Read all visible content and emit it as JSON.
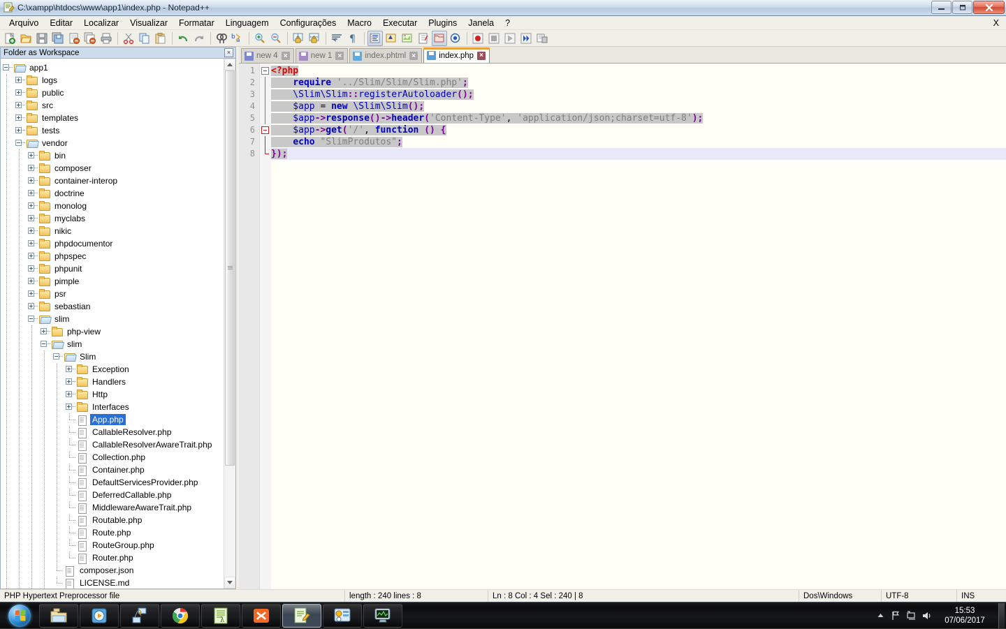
{
  "window": {
    "title": "C:\\xampp\\htdocs\\www\\app1\\index.php - Notepad++",
    "minimize_label": "—",
    "maximize_label": "❐",
    "close_label": "✕"
  },
  "menu": {
    "items": [
      {
        "label": "Arquivo"
      },
      {
        "label": "Editar"
      },
      {
        "label": "Localizar"
      },
      {
        "label": "Visualizar"
      },
      {
        "label": "Formatar"
      },
      {
        "label": "Linguagem"
      },
      {
        "label": "Configurações"
      },
      {
        "label": "Macro"
      },
      {
        "label": "Executar"
      },
      {
        "label": "Plugins"
      },
      {
        "label": "Janela"
      },
      {
        "label": "?"
      }
    ],
    "right_label": "X"
  },
  "toolbar": {
    "icons": [
      "new-file-icon",
      "open-file-icon",
      "save-icon",
      "save-all-icon",
      "close-file-icon",
      "close-all-icon",
      "print-icon",
      "cut-icon",
      "copy-icon",
      "paste-icon",
      "undo-icon",
      "redo-icon",
      "find-icon",
      "replace-icon",
      "zoom-in-icon",
      "zoom-out-icon",
      "sync-vertical-icon",
      "sync-horizontal-icon",
      "word-wrap-icon",
      "show-all-chars-icon",
      "indent-guide-icon",
      "user-language-icon",
      "document-map-icon",
      "function-list-icon",
      "folder-as-workspace-icon",
      "monitoring-icon",
      "record-macro-icon",
      "stop-record-icon",
      "play-macro-icon",
      "run-macro-multiple-icon",
      "save-macro-icon"
    ]
  },
  "panel": {
    "caption": "Folder as Workspace",
    "close_label": "×",
    "tree": [
      {
        "label": "app1",
        "depth": 0,
        "type": "project",
        "state": "expanded"
      },
      {
        "label": "logs",
        "depth": 1,
        "type": "folder",
        "state": "collapsed"
      },
      {
        "label": "public",
        "depth": 1,
        "type": "folder",
        "state": "collapsed"
      },
      {
        "label": "src",
        "depth": 1,
        "type": "folder",
        "state": "collapsed"
      },
      {
        "label": "templates",
        "depth": 1,
        "type": "folder",
        "state": "collapsed"
      },
      {
        "label": "tests",
        "depth": 1,
        "type": "folder",
        "state": "collapsed"
      },
      {
        "label": "vendor",
        "depth": 1,
        "type": "project",
        "state": "expanded"
      },
      {
        "label": "bin",
        "depth": 2,
        "type": "folder",
        "state": "collapsed"
      },
      {
        "label": "composer",
        "depth": 2,
        "type": "folder",
        "state": "collapsed"
      },
      {
        "label": "container-interop",
        "depth": 2,
        "type": "folder",
        "state": "collapsed"
      },
      {
        "label": "doctrine",
        "depth": 2,
        "type": "folder",
        "state": "collapsed"
      },
      {
        "label": "monolog",
        "depth": 2,
        "type": "folder",
        "state": "collapsed"
      },
      {
        "label": "myclabs",
        "depth": 2,
        "type": "folder",
        "state": "collapsed"
      },
      {
        "label": "nikic",
        "depth": 2,
        "type": "folder",
        "state": "collapsed"
      },
      {
        "label": "phpdocumentor",
        "depth": 2,
        "type": "folder",
        "state": "collapsed"
      },
      {
        "label": "phpspec",
        "depth": 2,
        "type": "folder",
        "state": "collapsed"
      },
      {
        "label": "phpunit",
        "depth": 2,
        "type": "folder",
        "state": "collapsed"
      },
      {
        "label": "pimple",
        "depth": 2,
        "type": "folder",
        "state": "collapsed"
      },
      {
        "label": "psr",
        "depth": 2,
        "type": "folder",
        "state": "collapsed"
      },
      {
        "label": "sebastian",
        "depth": 2,
        "type": "folder",
        "state": "collapsed"
      },
      {
        "label": "slim",
        "depth": 2,
        "type": "project",
        "state": "expanded"
      },
      {
        "label": "php-view",
        "depth": 3,
        "type": "folder",
        "state": "collapsed"
      },
      {
        "label": "slim",
        "depth": 3,
        "type": "project",
        "state": "expanded"
      },
      {
        "label": "Slim",
        "depth": 4,
        "type": "project",
        "state": "expanded"
      },
      {
        "label": "Exception",
        "depth": 5,
        "type": "folder",
        "state": "collapsed"
      },
      {
        "label": "Handlers",
        "depth": 5,
        "type": "folder",
        "state": "collapsed"
      },
      {
        "label": "Http",
        "depth": 5,
        "type": "folder",
        "state": "collapsed"
      },
      {
        "label": "Interfaces",
        "depth": 5,
        "type": "folder",
        "state": "collapsed"
      },
      {
        "label": "App.php",
        "depth": 5,
        "type": "file",
        "state": "selected"
      },
      {
        "label": "CallableResolver.php",
        "depth": 5,
        "type": "file",
        "state": "none"
      },
      {
        "label": "CallableResolverAwareTrait.php",
        "depth": 5,
        "type": "file",
        "state": "none"
      },
      {
        "label": "Collection.php",
        "depth": 5,
        "type": "file",
        "state": "none"
      },
      {
        "label": "Container.php",
        "depth": 5,
        "type": "file",
        "state": "none"
      },
      {
        "label": "DefaultServicesProvider.php",
        "depth": 5,
        "type": "file",
        "state": "none"
      },
      {
        "label": "DeferredCallable.php",
        "depth": 5,
        "type": "file",
        "state": "none"
      },
      {
        "label": "MiddlewareAwareTrait.php",
        "depth": 5,
        "type": "file",
        "state": "none"
      },
      {
        "label": "Routable.php",
        "depth": 5,
        "type": "file",
        "state": "none"
      },
      {
        "label": "Route.php",
        "depth": 5,
        "type": "file",
        "state": "none"
      },
      {
        "label": "RouteGroup.php",
        "depth": 5,
        "type": "file",
        "state": "none"
      },
      {
        "label": "Router.php",
        "depth": 5,
        "type": "file",
        "state": "none"
      },
      {
        "label": "composer.json",
        "depth": 4,
        "type": "file",
        "state": "none"
      },
      {
        "label": "LICENSE.md",
        "depth": 4,
        "type": "file",
        "state": "none"
      }
    ]
  },
  "tabs": [
    {
      "label": "new 4",
      "active": false,
      "close_label": "×",
      "icon_color": "#6f77c8"
    },
    {
      "label": "new 1",
      "active": false,
      "close_label": "×",
      "icon_color": "#9b7fc0"
    },
    {
      "label": "index.phtml",
      "active": false,
      "close_label": "×",
      "icon_color": "#4aa3e0"
    },
    {
      "label": "index.php",
      "active": true,
      "close_label": "×",
      "icon_color": "#3b8fd4"
    }
  ],
  "editor": {
    "line_numbers": [
      "1",
      "2",
      "3",
      "4",
      "5",
      "6",
      "7",
      "8"
    ],
    "lines": [
      {
        "n": 1,
        "tokens": [
          {
            "t": "<?php",
            "c": "k-tag",
            "sel": true
          }
        ]
      },
      {
        "n": 2,
        "tokens": [
          {
            "t": "    ",
            "c": "k-plain",
            "sel": true
          },
          {
            "t": "require",
            "c": "k-kw",
            "sel": true
          },
          {
            "t": " ",
            "c": "k-plain",
            "sel": true
          },
          {
            "t": "'../Slim/Slim/Slim.php'",
            "c": "k-str",
            "sel": true
          },
          {
            "t": ";",
            "c": "k-op",
            "sel": true
          }
        ]
      },
      {
        "n": 3,
        "tokens": [
          {
            "t": "    \\Slim\\Slim",
            "c": "k-var",
            "sel": true
          },
          {
            "t": "::",
            "c": "k-op",
            "sel": true
          },
          {
            "t": "registerAutoloader",
            "c": "k-var",
            "sel": true
          },
          {
            "t": "()",
            "c": "k-op",
            "sel": true
          },
          {
            "t": ";",
            "c": "k-op",
            "sel": true
          }
        ]
      },
      {
        "n": 4,
        "tokens": [
          {
            "t": "    $app",
            "c": "k-var",
            "sel": true
          },
          {
            "t": " = ",
            "c": "k-plain",
            "sel": true
          },
          {
            "t": "new",
            "c": "k-kw",
            "sel": true
          },
          {
            "t": " \\Slim\\Slim",
            "c": "k-var",
            "sel": true
          },
          {
            "t": "()",
            "c": "k-op",
            "sel": true
          },
          {
            "t": ";",
            "c": "k-op",
            "sel": true
          }
        ]
      },
      {
        "n": 5,
        "tokens": [
          {
            "t": "    $app",
            "c": "k-var",
            "sel": true
          },
          {
            "t": "->",
            "c": "k-op",
            "sel": true
          },
          {
            "t": "response",
            "c": "k-fn",
            "sel": true
          },
          {
            "t": "()",
            "c": "k-op",
            "sel": true
          },
          {
            "t": "->",
            "c": "k-op",
            "sel": true
          },
          {
            "t": "header",
            "c": "k-fn",
            "sel": true
          },
          {
            "t": "(",
            "c": "k-op",
            "sel": true
          },
          {
            "t": "'Content-Type'",
            "c": "k-str",
            "sel": true
          },
          {
            "t": ", ",
            "c": "k-plain",
            "sel": true
          },
          {
            "t": "'application/json;charset=utf-8'",
            "c": "k-str",
            "sel": true
          },
          {
            "t": ")",
            "c": "k-op",
            "sel": true
          },
          {
            "t": ";",
            "c": "k-op",
            "sel": true
          }
        ]
      },
      {
        "n": 6,
        "tokens": [
          {
            "t": "    $app",
            "c": "k-var",
            "sel": true
          },
          {
            "t": "->",
            "c": "k-op",
            "sel": true
          },
          {
            "t": "get",
            "c": "k-fn",
            "sel": true
          },
          {
            "t": "(",
            "c": "k-op",
            "sel": true
          },
          {
            "t": "'/'",
            "c": "k-str",
            "sel": true
          },
          {
            "t": ", ",
            "c": "k-plain",
            "sel": true
          },
          {
            "t": "function",
            "c": "k-kw",
            "sel": true
          },
          {
            "t": " ",
            "c": "k-plain",
            "sel": true
          },
          {
            "t": "()",
            "c": "k-op",
            "sel": true
          },
          {
            "t": " ",
            "c": "k-plain",
            "sel": true
          },
          {
            "t": "{",
            "c": "k-op",
            "sel": true
          }
        ]
      },
      {
        "n": 7,
        "tokens": [
          {
            "t": "    ",
            "c": "k-plain",
            "sel": true
          },
          {
            "t": "echo",
            "c": "k-kw",
            "sel": true
          },
          {
            "t": " ",
            "c": "k-plain",
            "sel": true
          },
          {
            "t": "\"SlimProdutos\"",
            "c": "k-str",
            "sel": true
          },
          {
            "t": ";",
            "c": "k-op",
            "sel": true
          }
        ]
      },
      {
        "n": 8,
        "tokens": [
          {
            "t": "});",
            "c": "k-op",
            "sel": true
          }
        ]
      }
    ],
    "fold_markers": [
      {
        "line": 1,
        "type": "open",
        "color": "gray"
      },
      {
        "line": 6,
        "type": "open",
        "color": "red"
      },
      {
        "line": 8,
        "type": "end",
        "color": "red"
      }
    ]
  },
  "statusbar": {
    "doc_type": "PHP Hypertext Preprocessor file",
    "length_lines": "length : 240    lines : 8",
    "caret": "Ln : 8    Col : 4    Sel : 240 | 8",
    "eol": "Dos\\Windows",
    "encoding": "UTF-8",
    "insert_mode": "INS"
  },
  "taskbar": {
    "start_label": "Start",
    "buttons": [
      {
        "name": "windows-explorer",
        "icon": "folder-icon",
        "active": false
      },
      {
        "name": "windows-media-player",
        "icon": "media-player-icon",
        "active": false
      },
      {
        "name": "network-tool",
        "icon": "network-icon",
        "active": false
      },
      {
        "name": "google-chrome",
        "icon": "chrome-icon",
        "active": false
      },
      {
        "name": "notepad-app",
        "icon": "green-doc-icon",
        "active": false
      },
      {
        "name": "xampp-control",
        "icon": "xampp-icon",
        "active": false
      },
      {
        "name": "notepad-plus-plus",
        "icon": "npp-icon",
        "active": true
      },
      {
        "name": "control-panel",
        "icon": "control-panel-icon",
        "active": false
      },
      {
        "name": "system-monitor",
        "icon": "monitor-icon",
        "active": false
      }
    ],
    "tray": [
      {
        "name": "show-hidden-icons",
        "glyph": "▲"
      },
      {
        "name": "action-center-flag",
        "glyph": "⚑"
      },
      {
        "name": "network-tray-icon",
        "glyph": "⌸"
      },
      {
        "name": "volume-tray-icon",
        "glyph": "ὐA"
      }
    ],
    "clock_time": "15:53",
    "clock_date": "07/06/2017"
  }
}
